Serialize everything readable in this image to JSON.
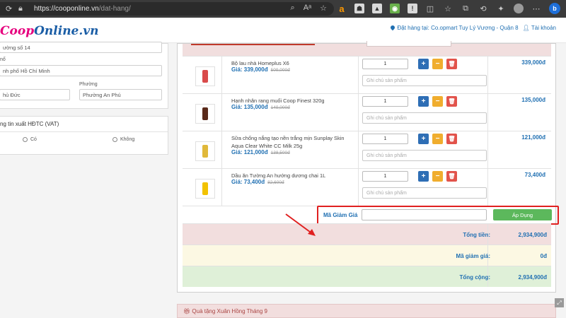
{
  "browser": {
    "url_host": "https://cooponline.vn",
    "url_path": "/dat-hang/"
  },
  "header": {
    "logo_part1": "Coop",
    "logo_part2": "Online.vn",
    "store_label": "Đặt hàng tại: Co.opmart Tuy Lý Vương - Quận 8",
    "account_label": "Tài khoản"
  },
  "address_form": {
    "street_value": "ường số 14",
    "city_label": "nố",
    "city_value": "nh phố Hồ Chí Minh",
    "district_value": "hủ Đức",
    "ward_label": "Phường",
    "ward_value": "Phường An Phú"
  },
  "vat": {
    "title": "ng tin xuất HĐTC (VAT)",
    "option_yes": "Có",
    "option_no": "Không"
  },
  "cart": {
    "items": [
      {
        "name": "Bộ lau nhà Homeplus X6",
        "price": "Giá: 339,000đ",
        "old_price": "509,000đ",
        "qty": "1",
        "note_placeholder": "Ghi chú sản phẩm",
        "total": "339,000đ",
        "thumb_color": "#d94a4a"
      },
      {
        "name": "Hạnh nhân rang muối Coop Finest 320g",
        "price": "Giá: 135,000đ",
        "old_price": "149,000đ",
        "qty": "1",
        "note_placeholder": "Ghi chú sản phẩm",
        "total": "135,000đ",
        "thumb_color": "#5a2a1a"
      },
      {
        "name": "Sữa chống nắng tạo nền trắng mịn Sunplay Skin Aqua Clear White CC Milk 25g",
        "price": "Giá: 121,000đ",
        "old_price": "138,500đ",
        "qty": "1",
        "note_placeholder": "Ghi chú sản phẩm",
        "total": "121,000đ",
        "thumb_color": "#e0b83a"
      },
      {
        "name": "Dầu ăn Tường An hướng dương chai 1L",
        "price": "Giá: 73,400đ",
        "old_price": "82,600đ",
        "qty": "1",
        "note_placeholder": "Ghi chú sản phẩm",
        "total": "73,400đ",
        "thumb_color": "#f2c200"
      }
    ],
    "coupon_label": "Mã Giảm Giá",
    "apply_label": "Áp Dụng",
    "total_label": "Tổng tiền:",
    "total_value": "2,934,900đ",
    "discount_label": "Mã giảm giá:",
    "discount_value": "0đ",
    "grand_label": "Tổng cộng:",
    "grand_value": "2,934,900đ"
  },
  "gift_bar": "Quà tặng Xuân Hồng Tháng 9"
}
